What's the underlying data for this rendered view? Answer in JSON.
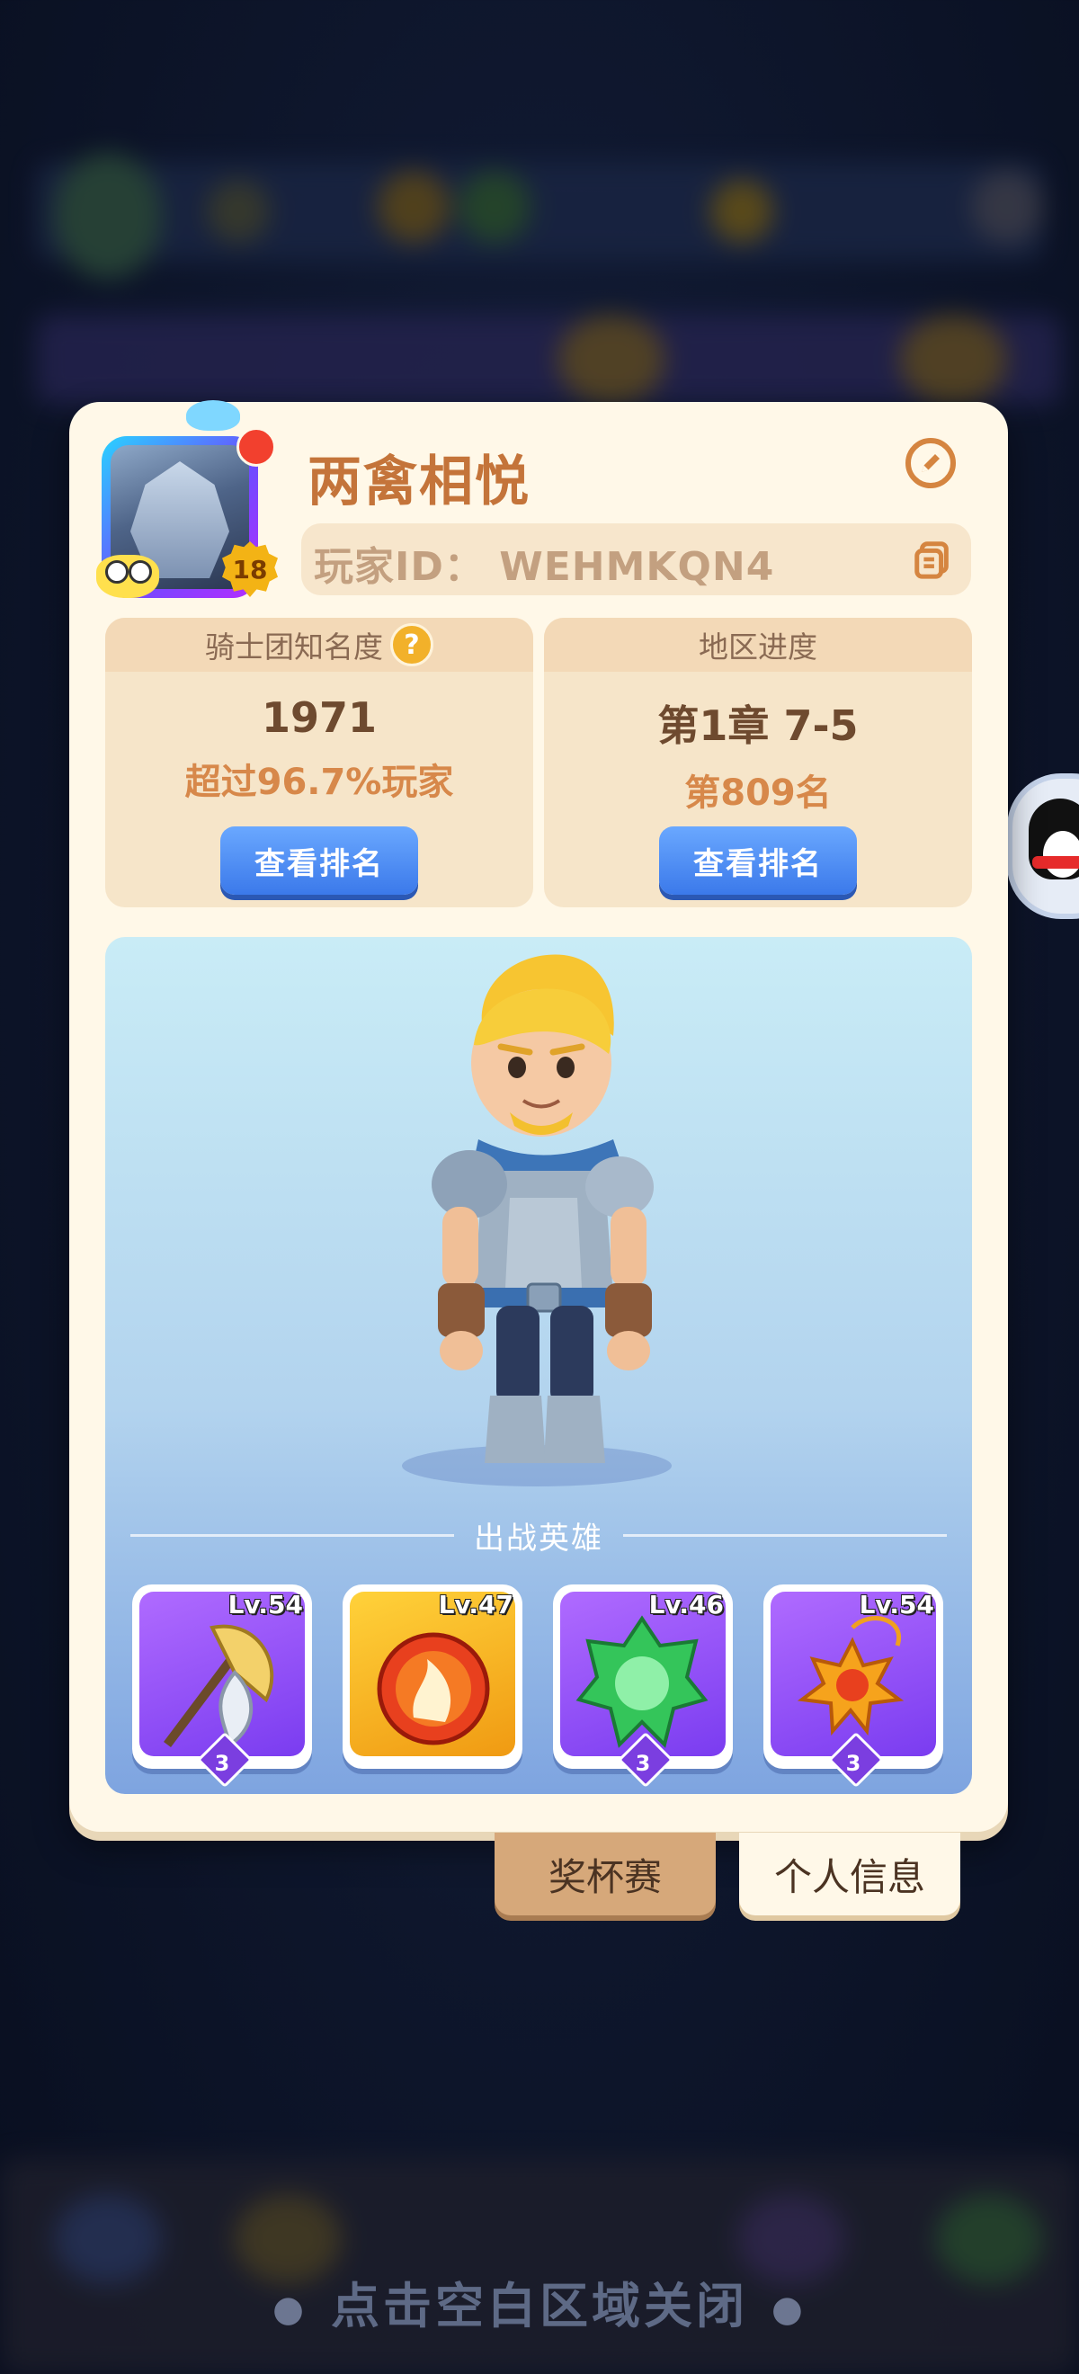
{
  "profile": {
    "player_name": "两禽相悦",
    "avatar_level": "18",
    "player_id_text": "玩家ID：  WEHMKQN4"
  },
  "stats": {
    "renown": {
      "title": "骑士团知名度",
      "value": "1971",
      "subtitle": "超过96.7%玩家",
      "button_label": "查看排名"
    },
    "region": {
      "title": "地区进度",
      "value": "第1章 7-5",
      "subtitle": "第809名",
      "button_label": "查看排名"
    }
  },
  "battle_heroes": {
    "section_title": "出战英雄",
    "items": [
      {
        "level": "Lv.54",
        "stars": "3",
        "icon": "golden-axe-icon",
        "bg": "purple"
      },
      {
        "level": "Lv.47",
        "stars": "",
        "icon": "fire-orb-icon",
        "bg": "orange"
      },
      {
        "level": "Lv.46",
        "stars": "3",
        "icon": "green-gem-icon",
        "bg": "purple"
      },
      {
        "level": "Lv.54",
        "stars": "3",
        "icon": "sun-amulet-icon",
        "bg": "purple"
      }
    ]
  },
  "tabs": {
    "trophy": "奖杯赛",
    "personal_info": "个人信息"
  },
  "close_hint": "点击空白区域关闭",
  "colors": {
    "card_bg": "#fff8e8",
    "name_color": "#c4743a",
    "button_blue": "#3b79ea",
    "badge_gold": "#f3b315"
  }
}
